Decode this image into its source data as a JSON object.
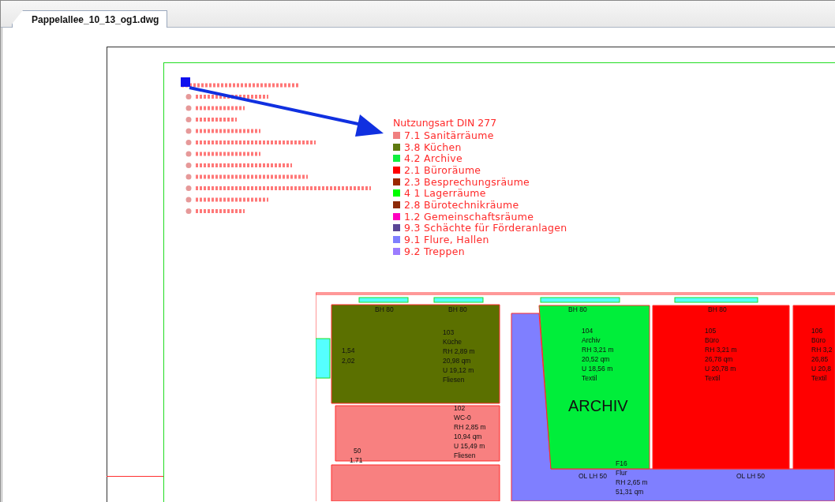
{
  "tab": {
    "label": "Pappelallee_10_13_og1.dwg",
    "selected": true
  },
  "legend": {
    "title": "Nutzungsart DIN 277",
    "items": [
      {
        "label": "7.1 Sanitärräume",
        "color": "#f08080"
      },
      {
        "label": "3.8 Küchen",
        "color": "#5e7a10"
      },
      {
        "label": "4.2 Archive",
        "color": "#10f040"
      },
      {
        "label": "2.1 Büroräume",
        "color": "#ff0000"
      },
      {
        "label": "2.3 Besprechungsräume",
        "color": "#9a2800"
      },
      {
        "label": "4 1 Lagerräume",
        "color": "#00ff00"
      },
      {
        "label": "2.8 Bürotechnikräume",
        "color": "#8c2a08"
      },
      {
        "label": "1.2 Gemeinschaftsräume",
        "color": "#ff00c0"
      },
      {
        "label": "9.3 Schächte für Förderanlagen",
        "color": "#5a4696"
      },
      {
        "label": "9.1 Flure, Hallen",
        "color": "#7f7fff"
      },
      {
        "label": "9.2 Treppen",
        "color": "#9c7cff"
      }
    ]
  },
  "rooms": [
    {
      "color": "#5b7000",
      "label": [
        "103",
        "Küche",
        "RH 2,89 m",
        "20,98 qm",
        "U 19,12 m",
        "Fliesen"
      ]
    },
    {
      "color": "#f88080",
      "label": [
        "102",
        "WC-0",
        "RH 2,85 m",
        "10,94 qm",
        "U 15,49 m",
        "Fliesen"
      ]
    },
    {
      "color": "#f88080"
    },
    {
      "color": "#7f7fff",
      "label": [
        "F16",
        "Flur",
        "RH 2,65 m",
        "51,31 qm"
      ]
    },
    {
      "color": "#00ee3a",
      "label": [
        "104",
        "Archiv",
        "RH 3,21 m",
        "20,52 qm",
        "U 18,56 m",
        "Textil"
      ]
    },
    {
      "color": "#ff0000",
      "label": [
        "105",
        "Büro",
        "RH 3,21 m",
        "26,78 qm",
        "U 20,78 m",
        "Textil"
      ]
    },
    {
      "color": "#ff0000",
      "label": [
        "106",
        "Büro",
        "RH 3,2",
        "26,85",
        "U 20,8",
        "Textil"
      ]
    }
  ],
  "annotations": [
    "BH 80",
    "BH 80",
    "BH 80",
    "BH 80",
    "1,54",
    "2,02",
    "50",
    "1.71",
    "ARCHIV",
    "OL LH 50",
    "OL LH 50"
  ]
}
